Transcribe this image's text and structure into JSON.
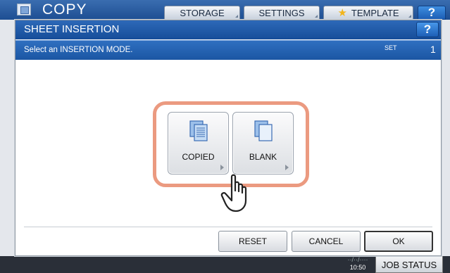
{
  "background": {
    "app_title": "COPY",
    "tabs": [
      {
        "label": "STORAGE"
      },
      {
        "label": "SETTINGS"
      },
      {
        "label": "TEMPLATE"
      }
    ],
    "help_label": "?",
    "clock_line1": "··/··/····",
    "clock_line2": "10:50",
    "job_status_label": "JOB STATUS"
  },
  "dialog": {
    "title": "SHEET INSERTION",
    "help_label": "?",
    "message": "Select an INSERTION MODE.",
    "set_label": "SET",
    "set_value": "1",
    "modes": [
      {
        "label": "COPIED",
        "icon": "copied-sheet-icon"
      },
      {
        "label": "BLANK",
        "icon": "blank-sheet-icon"
      }
    ],
    "footer": {
      "reset_label": "RESET",
      "cancel_label": "CANCEL",
      "ok_label": "OK"
    }
  },
  "colors": {
    "title_blue": "#1d4e92",
    "highlight_frame": "#eb9a80"
  }
}
